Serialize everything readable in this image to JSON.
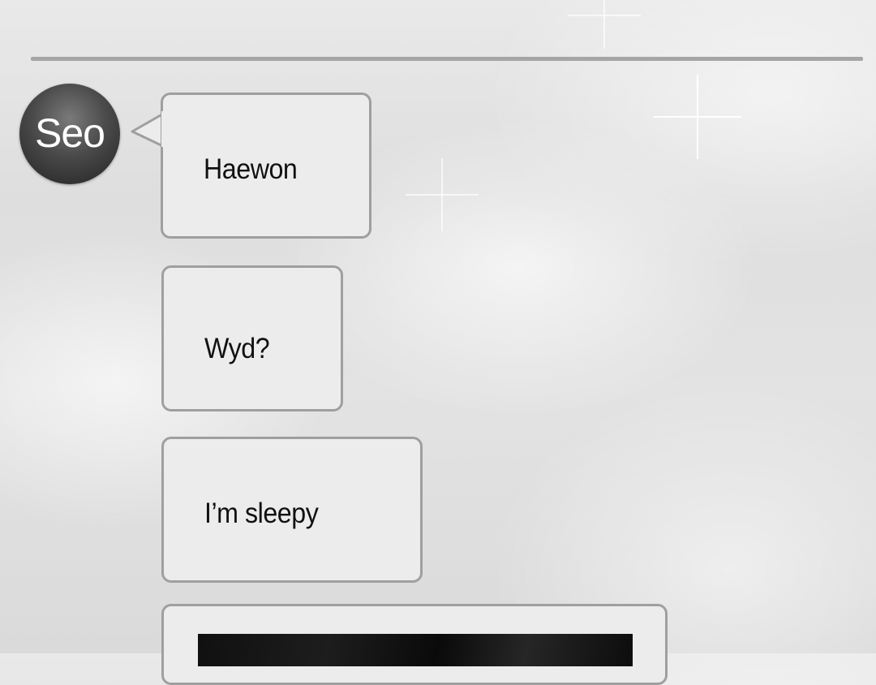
{
  "chat": {
    "sender": {
      "avatar_label": "Seo"
    },
    "messages": [
      {
        "text": "Haewon"
      },
      {
        "text": "Wyd?"
      },
      {
        "text": "I’m sleepy"
      },
      {
        "text": ""
      }
    ]
  },
  "theme": {
    "bubble_fill": "#ececec",
    "bubble_border": "#9f9f9f",
    "avatar_color": "#3a3a3a",
    "divider_color": "#a5a5a5"
  }
}
